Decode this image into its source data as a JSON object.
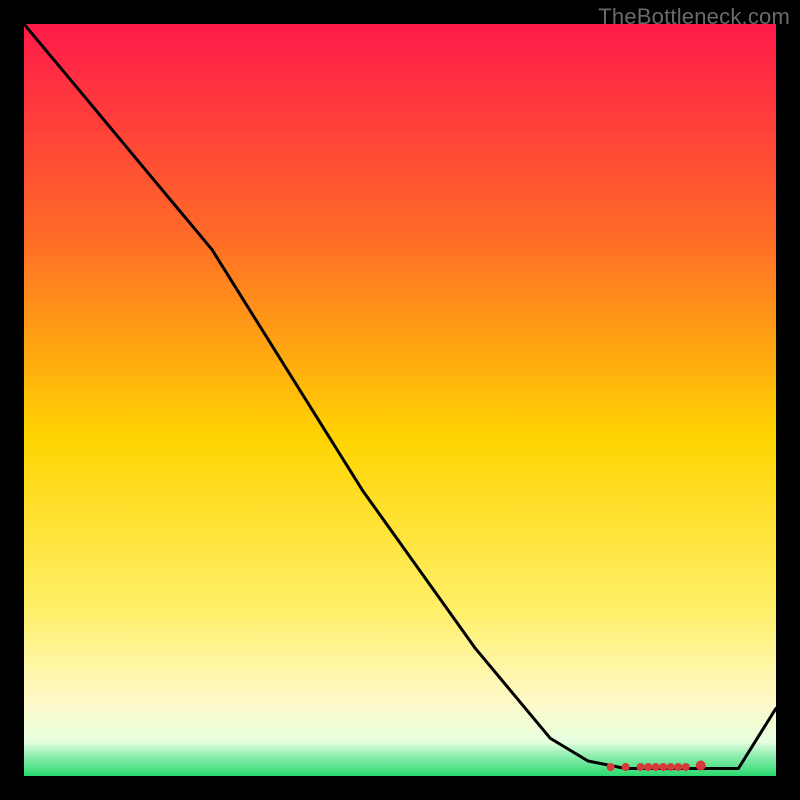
{
  "attribution": "TheBottleneck.com",
  "colors": {
    "top": "#ff1a4a",
    "mid_upper": "#ff7a1e",
    "mid": "#ffd400",
    "mid_lower": "#fff28a",
    "bottom": "#2bd96d",
    "line": "#000000",
    "marker": "#d63b3b",
    "background": "#000000"
  },
  "chart_data": {
    "type": "line",
    "title": "",
    "xlabel": "",
    "ylabel": "",
    "x": [
      0.0,
      0.05,
      0.1,
      0.15,
      0.2,
      0.25,
      0.3,
      0.35,
      0.4,
      0.45,
      0.5,
      0.55,
      0.6,
      0.65,
      0.7,
      0.75,
      0.8,
      0.85,
      0.9,
      0.95,
      1.0
    ],
    "values": [
      100,
      94,
      88,
      82,
      76,
      70,
      62,
      54,
      46,
      38,
      31,
      24,
      17,
      11,
      5,
      2,
      1,
      1,
      1,
      1,
      9
    ],
    "xlim": [
      0,
      1
    ],
    "ylim": [
      0,
      100
    ],
    "markers_x": [
      0.78,
      0.8,
      0.82,
      0.83,
      0.84,
      0.85,
      0.86,
      0.87,
      0.88,
      0.9
    ],
    "markers_y": [
      1.2,
      1.2,
      1.2,
      1.2,
      1.2,
      1.2,
      1.2,
      1.2,
      1.2,
      1.4
    ],
    "series": [
      {
        "name": "curve",
        "values": [
          100,
          94,
          88,
          82,
          76,
          70,
          62,
          54,
          46,
          38,
          31,
          24,
          17,
          11,
          5,
          2,
          1,
          1,
          1,
          1,
          9
        ]
      }
    ]
  }
}
